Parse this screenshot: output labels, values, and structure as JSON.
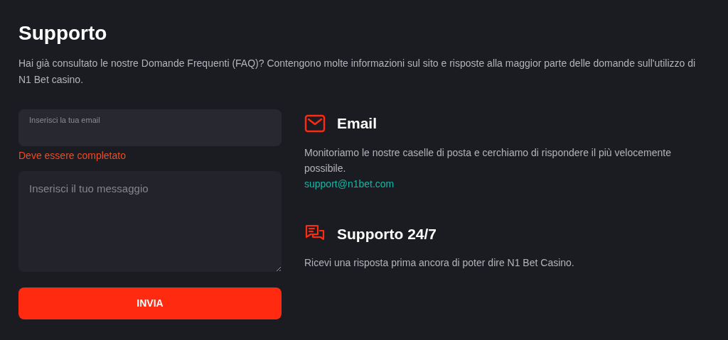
{
  "title": "Supporto",
  "intro": "Hai già consultato le nostre Domande Frequenti (FAQ)? Contengono molte informazioni sul sito e risposte alla maggior parte delle domande sull'utilizzo di N1 Bet casino.",
  "form": {
    "email": {
      "label": "Inserisci la tua email",
      "error": "Deve essere completato"
    },
    "message": {
      "placeholder": "Inserisci il tuo messaggio"
    },
    "submit": "INVIA"
  },
  "contacts": [
    {
      "kind": "email",
      "title": "Email",
      "text": "Monitoriamo le nostre caselle di posta e cerchiamo di rispondere il più velocemente possibile.",
      "link": "support@n1bet.com"
    },
    {
      "kind": "chat",
      "title": "Supporto 24/7",
      "text": "Ricevi una risposta prima ancora di poter dire N1 Bet Casino."
    }
  ]
}
